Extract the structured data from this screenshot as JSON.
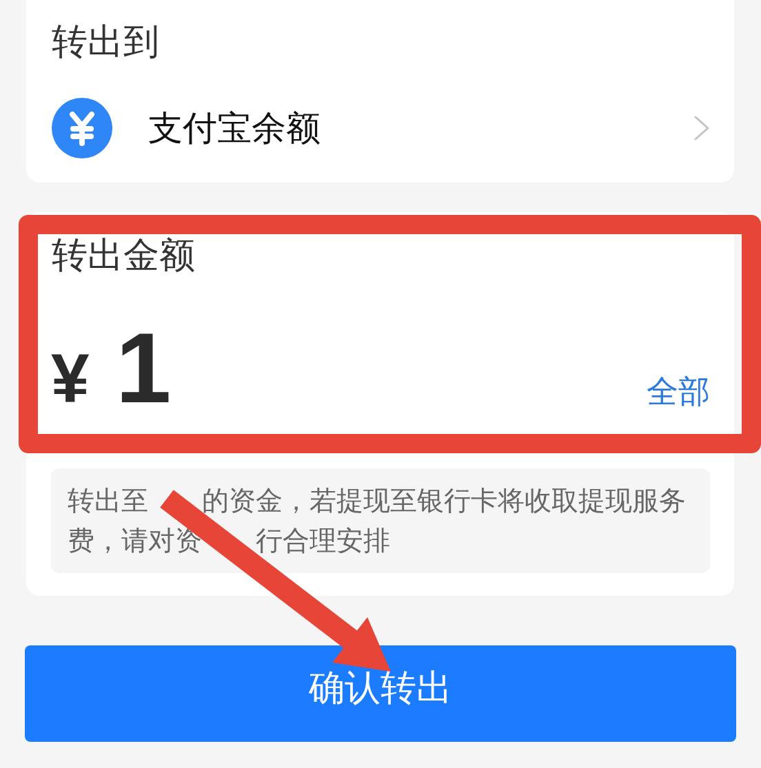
{
  "transfer_to": {
    "title": "转出到",
    "account": {
      "name": "支付宝余额"
    }
  },
  "amount": {
    "title": "转出金额",
    "currency": "¥",
    "value": "1",
    "all_button": "全部",
    "note_lines": [
      [
        "转出至",
        "的资金，若提现至银行卡将收取提现服务"
      ],
      [
        "费，请对资",
        "行合理安排"
      ]
    ]
  },
  "confirm_button": "确认转出"
}
